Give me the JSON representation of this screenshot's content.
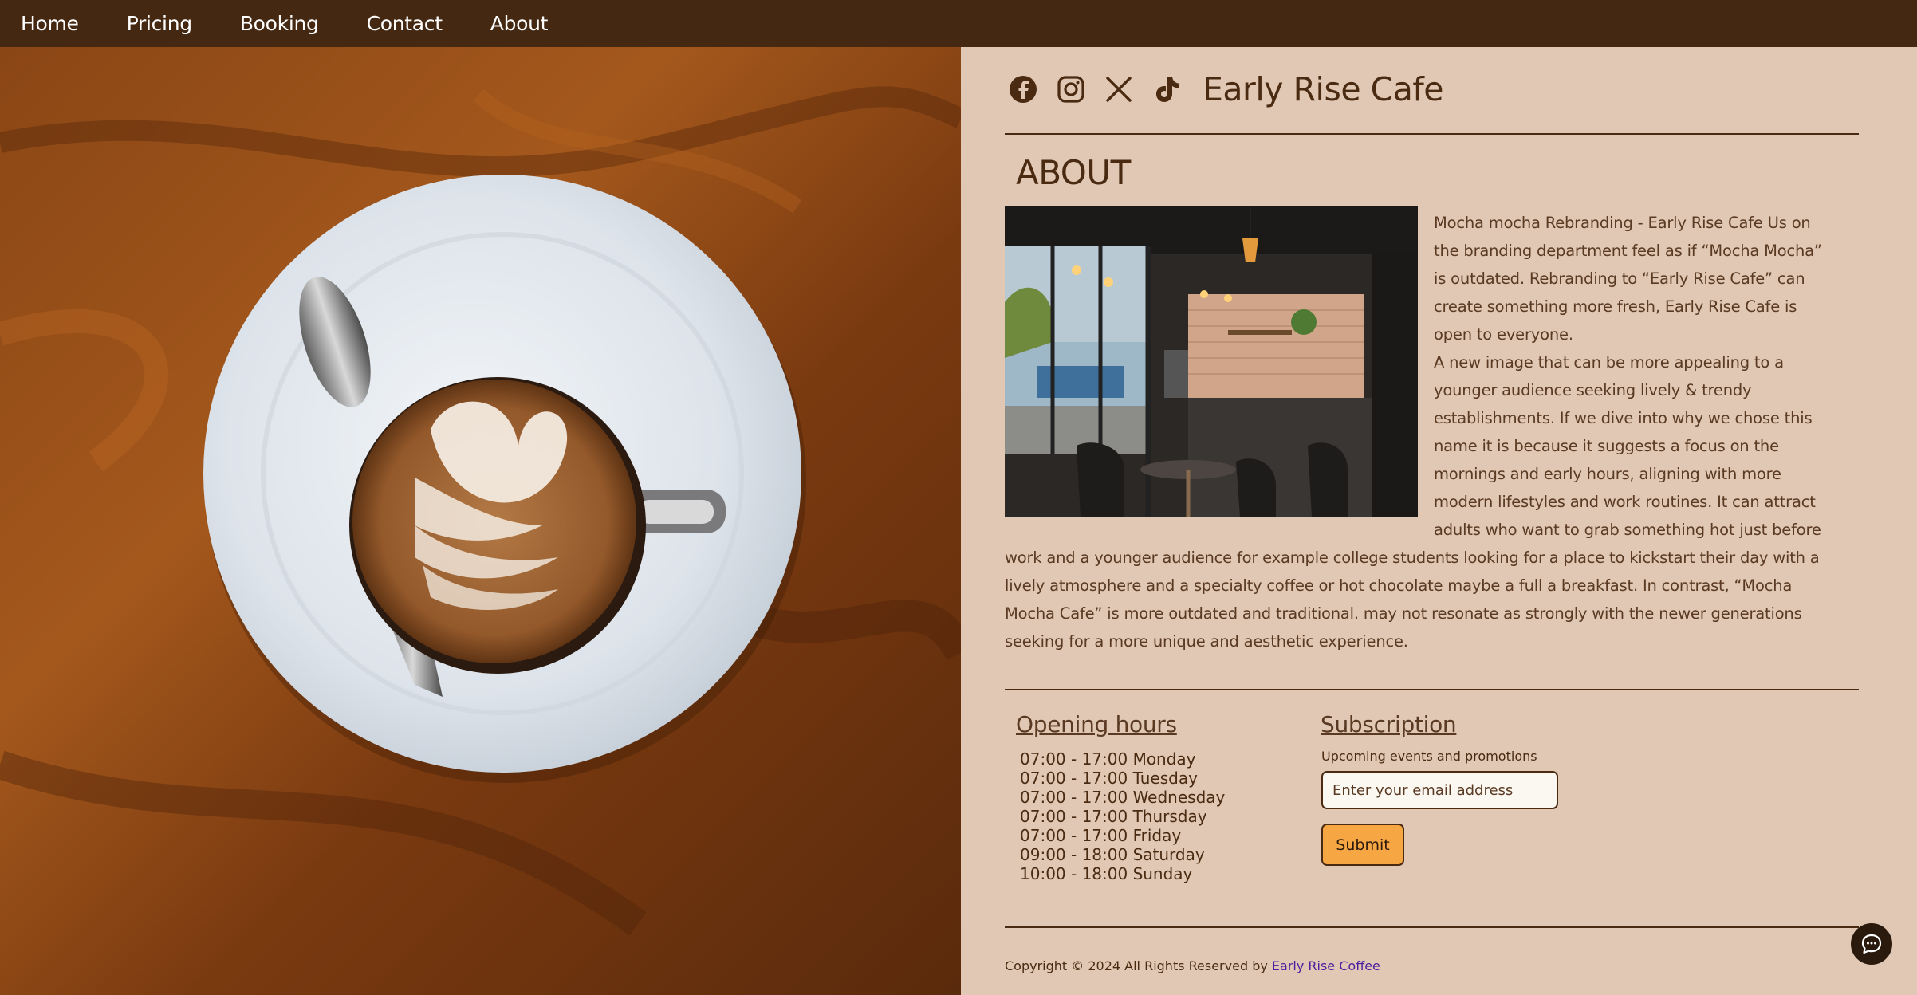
{
  "nav": {
    "items": [
      {
        "label": "Home"
      },
      {
        "label": "Pricing"
      },
      {
        "label": "Booking"
      },
      {
        "label": "Contact"
      },
      {
        "label": "About"
      }
    ]
  },
  "hero": {
    "icon": "latte-coffee-cup-photo"
  },
  "header": {
    "brand": "Early Rise Cafe",
    "social": [
      "facebook-icon",
      "instagram-icon",
      "x-icon",
      "tiktok-icon"
    ]
  },
  "about": {
    "heading": "ABOUT",
    "paragraph1": "Mocha mocha Rebranding - Early Rise Cafe Us on the branding department feel as if “Mocha Mocha” is outdated. Rebranding to “Early Rise Cafe” can create something more fresh, Early Rise Cafe is open to everyone.",
    "paragraph2": "A new image that can be more appealing to a younger audience seeking lively & trendy establishments. If we dive into why we chose this name it is because it suggests a focus on the mornings and early hours, aligning with more modern lifestyles and work routines. It can attract adults who want to grab something hot just before work and a younger audience for example college students looking for a place to kickstart their day with a lively atmosphere and a specialty coffee or hot chocolate maybe a full a breakfast. In contrast, “Mocha Mocha Cafe” is more outdated and traditional. may not resonate as strongly with the newer generations seeking for a more unique and aesthetic experience."
  },
  "hours": {
    "heading": "Opening hours",
    "rows": [
      "07:00 - 17:00 Monday",
      "07:00 - 17:00 Tuesday",
      "07:00 - 17:00 Wednesday",
      "07:00 - 17:00 Thursday",
      "07:00 - 17:00 Friday",
      "09:00 - 18:00 Saturday",
      "10:00 - 18:00 Sunday"
    ]
  },
  "subscription": {
    "heading": "Subscription",
    "caption": "Upcoming events and promotions",
    "email_placeholder": "Enter your email address",
    "submit_label": "Submit"
  },
  "footer": {
    "copyright": "Copyright © 2024 All Rights Reserved by",
    "link": "Early Rise Coffee"
  },
  "colors": {
    "nav_bg": "#452812",
    "panel_bg": "#e0c8b4",
    "text": "#4a2b12",
    "button": "#f6a744",
    "link": "#4b1ea0"
  }
}
